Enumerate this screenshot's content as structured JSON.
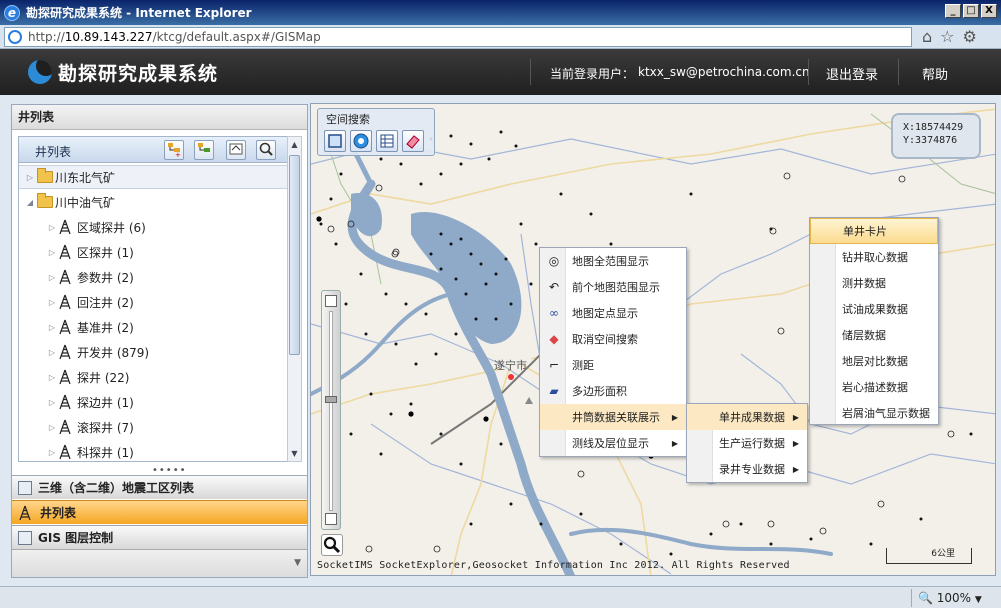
{
  "window": {
    "title": "勘探研究成果系统 - Internet Explorer",
    "buttons": [
      "_",
      "□",
      "X"
    ]
  },
  "address": {
    "protocol": "http://",
    "host": "10.89.143.227",
    "path": "/ktcg/default.aspx#/GISMap"
  },
  "app": {
    "title": "勘探研究成果系统",
    "user_label": "当前登录用户：",
    "user_email": "ktxx_sw@petrochina.com.cn",
    "logout": "退出登录",
    "help": "帮助"
  },
  "left": {
    "panel_title": "井列表",
    "toolbar_label": "井列表",
    "tree": [
      {
        "label": "川东北气矿",
        "type": "folder",
        "expanded": false
      },
      {
        "label": "川中油气矿",
        "type": "folder",
        "expanded": true
      },
      {
        "label": "区域探井 (6)",
        "type": "well"
      },
      {
        "label": "区探井 (1)",
        "type": "well"
      },
      {
        "label": "参数井 (2)",
        "type": "well"
      },
      {
        "label": "回注井 (2)",
        "type": "well"
      },
      {
        "label": "基准井 (2)",
        "type": "well"
      },
      {
        "label": "开发井 (879)",
        "type": "well"
      },
      {
        "label": "探井 (22)",
        "type": "well"
      },
      {
        "label": "探边井 (1)",
        "type": "well"
      },
      {
        "label": "滚探井 (7)",
        "type": "well"
      },
      {
        "label": "科探井 (1)",
        "type": "well"
      }
    ],
    "accordion": [
      {
        "label": "三维（含二维）地震工区列表",
        "active": false
      },
      {
        "label": "井列表",
        "active": true
      },
      {
        "label": "GIS 图层控制",
        "active": false
      }
    ]
  },
  "map": {
    "spatial_search_label": "空间搜索",
    "coord_x": "X:18574429",
    "coord_y": "Y:3374876",
    "city": "遂宁市",
    "copyright": "SocketIMS SocketExplorer,Geosocket Information Inc 2012. All Rights Reserved",
    "scale": "6公里"
  },
  "menu1": [
    {
      "label": "地图全范围显示",
      "icon": "globe-icon"
    },
    {
      "label": "前个地图范围显示",
      "icon": "undo-icon"
    },
    {
      "label": "地图定点显示",
      "icon": "binoculars-icon"
    },
    {
      "label": "取消空间搜索",
      "icon": "eraser-icon"
    },
    {
      "label": "测距",
      "icon": "measure-icon"
    },
    {
      "label": "多边形面积",
      "icon": "polygon-icon"
    },
    {
      "label": "井筒数据关联展示",
      "icon": "",
      "submenu": true
    },
    {
      "label": "测线及层位显示",
      "icon": "",
      "submenu": true
    }
  ],
  "menu2": [
    {
      "label": "单井成果数据",
      "submenu": true
    },
    {
      "label": "生产运行数据",
      "submenu": true
    },
    {
      "label": "录井专业数据",
      "submenu": true
    }
  ],
  "menu3": [
    {
      "label": "单井卡片"
    },
    {
      "label": "钻井取心数据"
    },
    {
      "label": "测井数据"
    },
    {
      "label": "试油成果数据"
    },
    {
      "label": "储层数据"
    },
    {
      "label": "地层对比数据"
    },
    {
      "label": "岩心描述数据"
    },
    {
      "label": "岩屑油气显示数据"
    }
  ],
  "status": {
    "zoom": "100%"
  }
}
